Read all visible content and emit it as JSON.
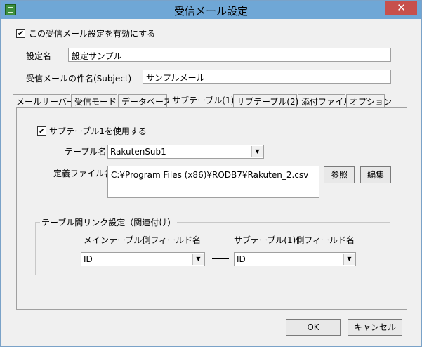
{
  "window": {
    "title": "受信メール設定",
    "close_glyph": "✕",
    "app_icon": "app-icon"
  },
  "enable_setting": {
    "label": "この受信メール設定を有効にする",
    "checked": true
  },
  "setting_name": {
    "label": "設定名",
    "value": "設定サンプル"
  },
  "subject": {
    "label": "受信メールの件名(Subject)",
    "value": "サンプルメール"
  },
  "tabs": [
    {
      "label": "メールサーバー"
    },
    {
      "label": "受信モード"
    },
    {
      "label": "データベース"
    },
    {
      "label": "サブテーブル(1)",
      "active": true
    },
    {
      "label": "サブテーブル(2)"
    },
    {
      "label": "添付ファイル"
    },
    {
      "label": "オプション"
    }
  ],
  "subtable": {
    "use_label": "サブテーブル1を使用する",
    "use_checked": true,
    "table_name_label": "テーブル名",
    "table_name_value": "RakutenSub1",
    "def_file_label": "定義ファイル名",
    "def_file_value": "C:¥Program Files (x86)¥RODB7¥Rakuten_2.csv",
    "browse_label": "参照",
    "edit_label": "編集"
  },
  "link": {
    "group_title": "テーブル間リンク設定（関連付け）",
    "main_field_label": "メインテーブル側フィールド名",
    "main_field_value": "ID",
    "sub_field_label": "サブテーブル(1)側フィールド名",
    "sub_field_value": "ID",
    "separator": "—"
  },
  "buttons": {
    "ok": "OK",
    "cancel": "キャンセル"
  },
  "colors": {
    "titlebar": "#6fa7d6",
    "close": "#c7504c",
    "face": "#f0f0f0"
  },
  "icons": {
    "dropdown": "chevron-down-icon",
    "check": "checkmark-icon"
  }
}
